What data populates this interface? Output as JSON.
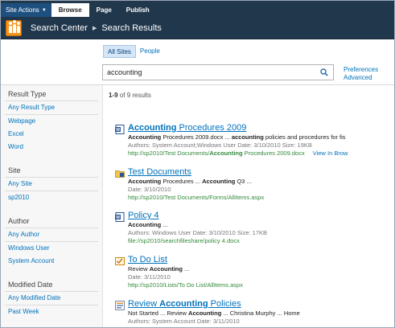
{
  "ribbon": {
    "site_actions": "Site Actions",
    "tabs": [
      "Browse",
      "Page",
      "Publish"
    ]
  },
  "header": {
    "breadcrumb": [
      "Search Center",
      "Search Results"
    ]
  },
  "search": {
    "scopes": [
      "All Sites",
      "People"
    ],
    "query": "accounting",
    "links": [
      "Preferences",
      "Advanced"
    ]
  },
  "results_count": {
    "range": "1-9",
    "rest": "of 9 results"
  },
  "refinement": [
    {
      "title": "Result Type",
      "items": [
        "Any Result Type",
        "Webpage",
        "Excel",
        "Word"
      ]
    },
    {
      "title": "Site",
      "items": [
        "Any Site",
        "sp2010"
      ]
    },
    {
      "title": "Author",
      "items": [
        "Any Author",
        "Windows User",
        "System Account"
      ]
    },
    {
      "title": "Modified Date",
      "items": [
        "Any Modified Date",
        "Past Week"
      ]
    }
  ],
  "results": [
    {
      "icon": "word-doc-icon",
      "title_bold": "Accounting",
      "title_rest": " Procedures 2009",
      "summary": [
        {
          "t": "Accounting",
          "b": true
        },
        {
          "t": " Procedures 2009.docx ... ",
          "b": false
        },
        {
          "t": "accounting",
          "b": true
        },
        {
          "t": " policies and procedures for fis",
          "b": false
        }
      ],
      "meta": "Authors: System Account;Windows User   Date: 3/10/2010   Size: 19KB",
      "url_pre": "http://sp2010/Test Documents/",
      "url_bold": "Accounting",
      "url_post": " Procedures 2009.docx",
      "view_in_browser": "View In Brow"
    },
    {
      "icon": "folder-icon",
      "title_bold": "",
      "title_rest": "Test Documents",
      "summary": [
        {
          "t": "Accounting",
          "b": true
        },
        {
          "t": " Procedures ... ",
          "b": false
        },
        {
          "t": "Accounting",
          "b": true
        },
        {
          "t": " Q3 ...",
          "b": false
        }
      ],
      "meta": "Date: 3/10/2010",
      "url_pre": "http://sp2010/Test Documents/Forms/AllItems.aspx",
      "url_bold": "",
      "url_post": "",
      "view_in_browser": ""
    },
    {
      "icon": "word-doc-icon",
      "title_bold": "",
      "title_rest": "Policy 4",
      "summary": [
        {
          "t": "Accounting",
          "b": true
        },
        {
          "t": " ...",
          "b": false
        }
      ],
      "meta": "Authors: Windows User   Date: 3/10/2010   Size: 17KB",
      "url_pre": "file://sp2010/searchfileshare/policy 4.docx",
      "url_bold": "",
      "url_post": "",
      "view_in_browser": ""
    },
    {
      "icon": "task-list-icon",
      "title_bold": "",
      "title_rest": "To Do List",
      "summary": [
        {
          "t": "Review ",
          "b": false
        },
        {
          "t": "Accounting",
          "b": true
        },
        {
          "t": " ...",
          "b": false
        }
      ],
      "meta": "Date: 3/11/2010",
      "url_pre": "http://sp2010/Lists/To Do List/AllItems.aspx",
      "url_bold": "",
      "url_post": "",
      "view_in_browser": ""
    },
    {
      "icon": "list-item-icon",
      "title_bold": "Accounting",
      "title_pre": "Review ",
      "title_rest": " Policies",
      "summary": [
        {
          "t": "Review ",
          "b": false
        },
        {
          "t": "Accounting",
          "b": true
        },
        {
          "t": " ... Christina Murphy ... Home",
          "b": false
        }
      ],
      "summary_prefix": "Not Started ... ",
      "meta": "Authors: System Account   Date: 3/11/2010",
      "url_pre": "",
      "url_bold": "",
      "url_post": "",
      "view_in_browser": ""
    }
  ],
  "colors": {
    "ribbon": "#21374c",
    "link": "#0072bc",
    "url_green": "#338a3c",
    "logo_orange": "#f7941d"
  }
}
